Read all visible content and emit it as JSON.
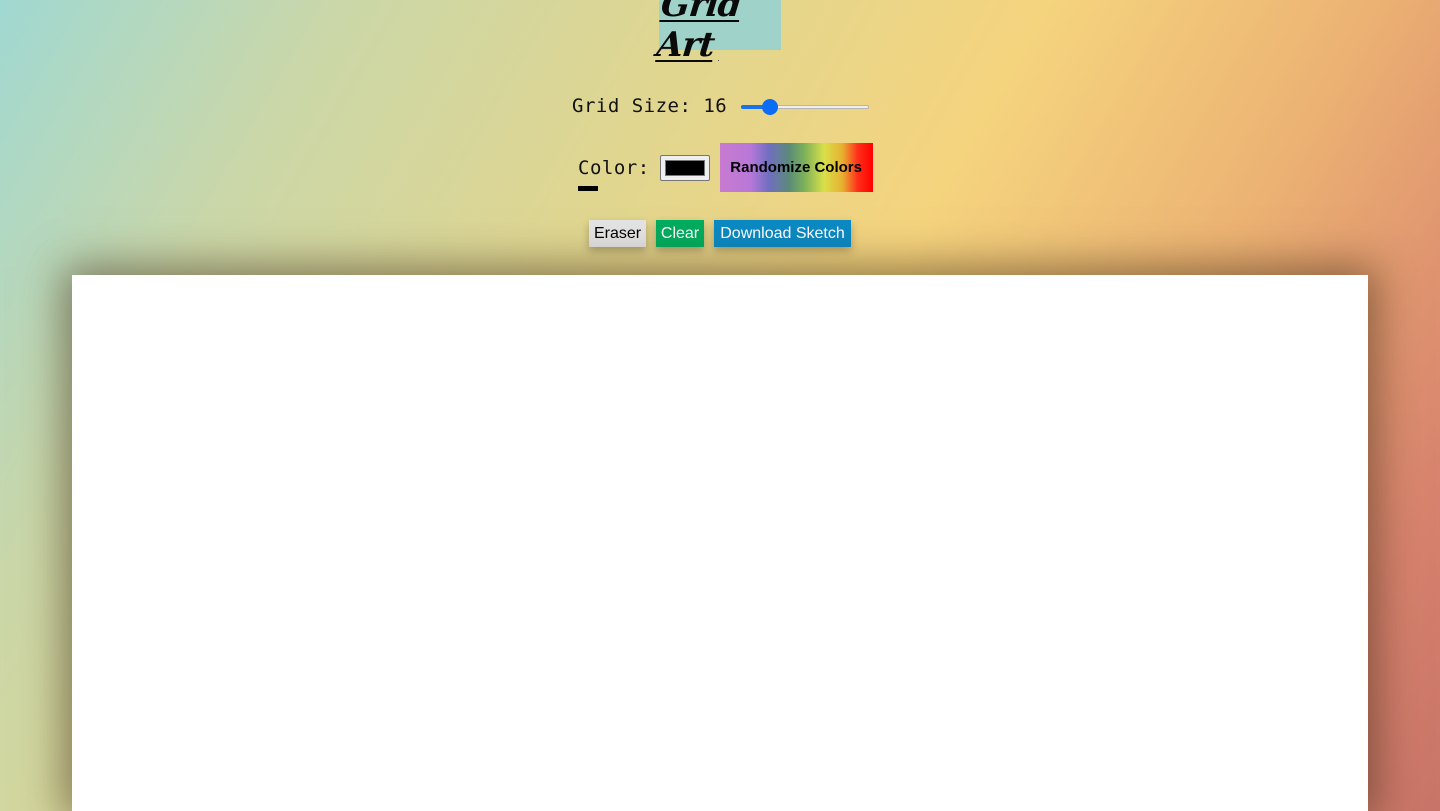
{
  "header": {
    "title": "Grid Art"
  },
  "grid_size": {
    "label": "Grid Size: 16",
    "value": 16,
    "min": 1,
    "max": 100,
    "fraction": 0.19
  },
  "color": {
    "label": "Color:",
    "value": "#000000"
  },
  "toolbar": {
    "randomize_label": "Randomize Colors",
    "eraser_label": "Eraser",
    "clear_label": "Clear",
    "download_label": "Download Sketch"
  },
  "colors": {
    "clear_button": "#00ad5e",
    "download_button": "#0a8ac4",
    "eraser_button": "#e4e4e4",
    "title_background": "#9fd2c8",
    "canvas": "#ffffff"
  }
}
